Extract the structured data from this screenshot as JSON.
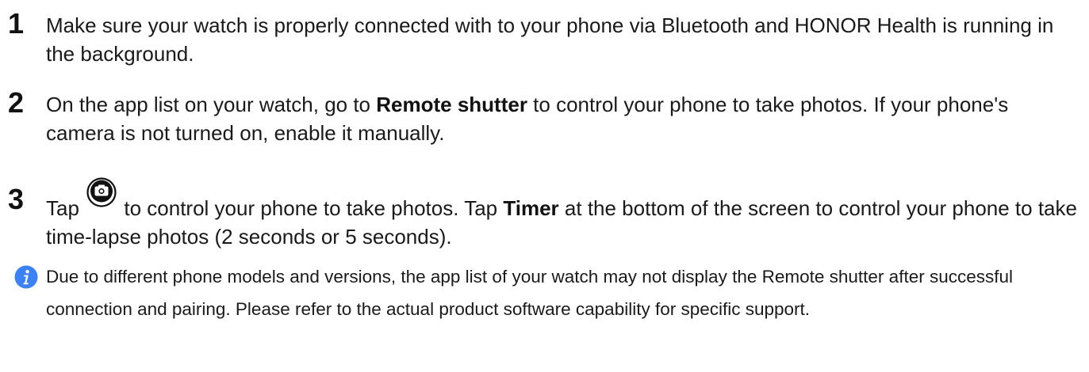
{
  "steps": [
    {
      "number": "1",
      "text_a": "Make sure your watch is properly connected with to your phone via Bluetooth and HONOR Health is running in the background."
    },
    {
      "number": "2",
      "text_a": "On the app list on your watch, go to ",
      "bold_a": "Remote shutter",
      "text_b": " to control your phone to take photos. If your phone's camera is not turned on, enable it manually."
    },
    {
      "number": "3",
      "text_a": "Tap ",
      "icon": "camera-shutter-icon",
      "text_b": " to control your phone to take photos. Tap ",
      "bold_a": "Timer",
      "text_c": " at the bottom of the screen to control your phone to take time-lapse photos (2 seconds or 5 seconds)."
    }
  ],
  "note": {
    "icon": "info-icon",
    "text": "Due to different phone models and versions, the app list of your watch may not display the Remote shutter after successful connection and pairing. Please refer to the actual product software capability for specific support."
  },
  "colors": {
    "text": "#1a1a1a",
    "info_icon": "#3b82f6",
    "camera_icon": "#111111"
  }
}
